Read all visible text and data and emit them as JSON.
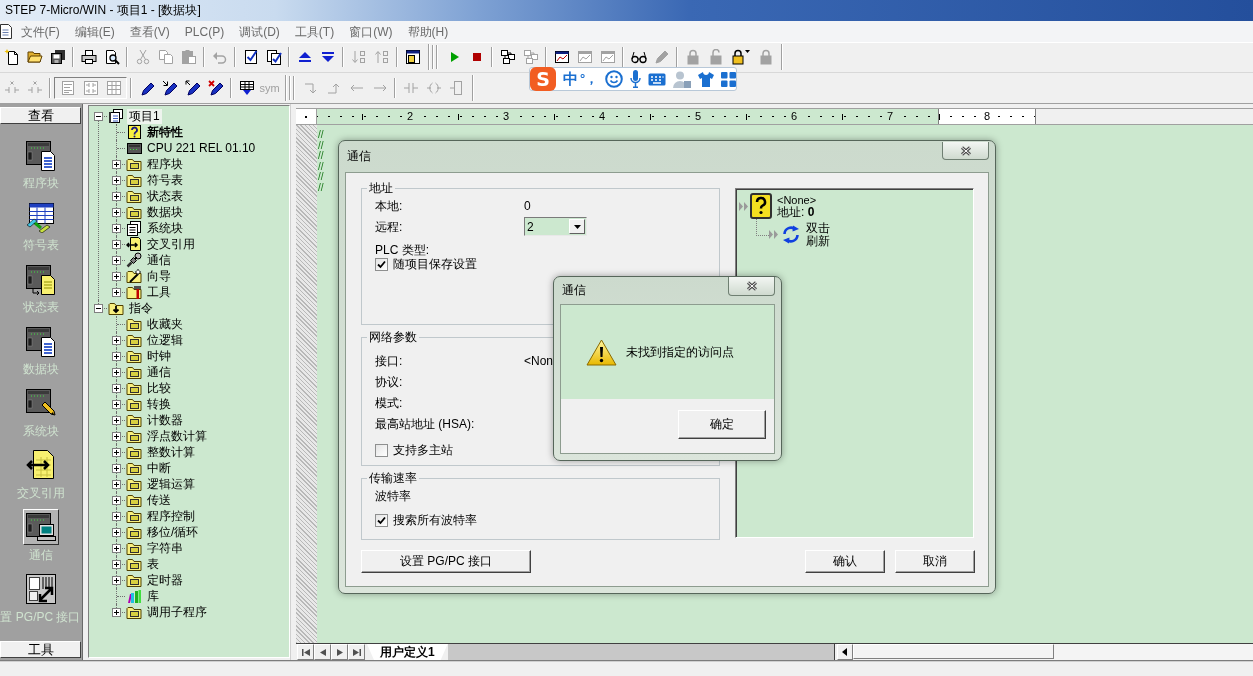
{
  "window": {
    "title": "STEP 7-Micro/WIN - 项目1 - [数据块]"
  },
  "menu": [
    "文件(F)",
    "编辑(E)",
    "查看(V)",
    "PLC(P)",
    "调试(D)",
    "工具(T)",
    "窗口(W)",
    "帮助(H)"
  ],
  "toolbar_rows": [
    {
      "bands": [
        {
          "groups": [
            {
              "items": [
                {
                  "kind": "new",
                  "disabled": false
                },
                {
                  "kind": "open",
                  "disabled": false
                },
                {
                  "kind": "save_all",
                  "disabled": false
                }
              ]
            },
            {
              "items": [
                {
                  "kind": "print",
                  "disabled": false
                },
                {
                  "kind": "print_preview",
                  "disabled": false
                }
              ]
            },
            {
              "items": [
                {
                  "kind": "cut",
                  "disabled": true
                },
                {
                  "kind": "copy",
                  "disabled": true
                },
                {
                  "kind": "paste",
                  "disabled": true
                }
              ]
            },
            {
              "items": [
                {
                  "kind": "undo",
                  "disabled": true
                }
              ]
            },
            {
              "items": [
                {
                  "kind": "compile",
                  "disabled": false
                },
                {
                  "kind": "compile_all",
                  "disabled": false
                }
              ]
            },
            {
              "items": [
                {
                  "kind": "upload",
                  "disabled": false
                },
                {
                  "kind": "download",
                  "disabled": false
                }
              ]
            },
            {
              "items": [
                {
                  "kind": "sort_ascending",
                  "disabled": true
                },
                {
                  "kind": "sort_descending",
                  "disabled": true
                }
              ]
            },
            {
              "items": [
                {
                  "kind": "options",
                  "disabled": false
                }
              ]
            }
          ]
        },
        {
          "groups": [
            {
              "items": [
                {
                  "kind": "run",
                  "disabled": false
                },
                {
                  "kind": "stop",
                  "disabled": false
                }
              ]
            },
            {
              "items": [
                {
                  "kind": "program_status",
                  "disabled": false
                },
                {
                  "kind": "status_pause",
                  "disabled": true
                }
              ]
            },
            {
              "items": [
                {
                  "kind": "chart_status",
                  "disabled": false
                },
                {
                  "kind": "chart_pause",
                  "disabled": true
                },
                {
                  "kind": "chart_single",
                  "disabled": true
                }
              ]
            },
            {
              "items": [
                {
                  "kind": "force",
                  "disabled": false
                },
                {
                  "kind": "unforce",
                  "disabled": true
                }
              ]
            },
            {
              "items": [
                {
                  "kind": "lock",
                  "disabled": true
                },
                {
                  "kind": "unlock",
                  "disabled": true
                },
                {
                  "kind": "lock_menu",
                  "disabled": false
                },
                {
                  "kind": "unlock_all",
                  "disabled": true
                }
              ]
            }
          ]
        }
      ]
    },
    {
      "bands": [
        {
          "groups": [
            {
              "items": [
                {
                  "kind": "contact_x",
                  "disabled": true
                },
                {
                  "kind": "contact_x",
                  "disabled": true
                }
              ]
            },
            {
              "framed": true,
              "items": [
                {
                  "kind": "stl_view",
                  "disabled": true
                },
                {
                  "kind": "ladder_view",
                  "disabled": true
                },
                {
                  "kind": "fbd_view",
                  "disabled": true
                }
              ]
            },
            {
              "items": [
                {
                  "kind": "pen",
                  "disabled": false
                },
                {
                  "kind": "pen_in",
                  "disabled": false
                },
                {
                  "kind": "pen_out",
                  "disabled": false
                },
                {
                  "kind": "pen_delete",
                  "disabled": false
                }
              ]
            },
            {
              "items": [
                {
                  "kind": "table_arrow",
                  "disabled": false
                },
                {
                  "kind": "symbols",
                  "label": "sym",
                  "disabled": true
                }
              ]
            }
          ]
        },
        {
          "groups": [
            {
              "items": [
                {
                  "kind": "line_down",
                  "disabled": true
                },
                {
                  "kind": "line_up",
                  "disabled": true
                },
                {
                  "kind": "line_left",
                  "disabled": true
                },
                {
                  "kind": "line_right",
                  "disabled": true
                }
              ]
            },
            {
              "items": [
                {
                  "kind": "contact",
                  "disabled": true
                },
                {
                  "kind": "coil",
                  "disabled": true
                },
                {
                  "kind": "box",
                  "disabled": true
                }
              ]
            }
          ]
        }
      ]
    }
  ],
  "ime_bar": {
    "logo": "S",
    "mode": "中",
    "punctuation": "°，"
  },
  "navigation_bar": {
    "header": "查看",
    "items": [
      {
        "kind": "program",
        "label": "程序块",
        "selected": false
      },
      {
        "kind": "symbol",
        "label": "符号表",
        "selected": false
      },
      {
        "kind": "status",
        "label": "状态表",
        "selected": false
      },
      {
        "kind": "data",
        "label": "数据块",
        "selected": false
      },
      {
        "kind": "system",
        "label": "系统块",
        "selected": false
      },
      {
        "kind": "xref",
        "label": "交叉引用",
        "selected": false
      },
      {
        "kind": "comm",
        "label": "通信",
        "selected": true
      },
      {
        "kind": "pgpc",
        "label": "置 PG/PC 接口",
        "selected": false
      }
    ],
    "footer": "工具"
  },
  "tree": [
    {
      "label": "项目1",
      "kind": "project",
      "expanded": true,
      "selected": true,
      "children": [
        {
          "label": "新特性",
          "kind": "news",
          "selected": false
        },
        {
          "label": "CPU 221 REL 01.10",
          "kind": "cpu",
          "selected": false
        },
        {
          "label": "程序块",
          "kind": "folder",
          "expanded": false,
          "selected": false
        },
        {
          "label": "符号表",
          "kind": "folder",
          "expanded": false,
          "selected": false
        },
        {
          "label": "状态表",
          "kind": "folder",
          "expanded": false,
          "selected": false
        },
        {
          "label": "数据块",
          "kind": "folder",
          "expanded": false,
          "selected": false
        },
        {
          "label": "系统块",
          "kind": "pages",
          "expanded": false,
          "selected": false
        },
        {
          "label": "交叉引用",
          "kind": "xref",
          "expanded": false,
          "selected": false
        },
        {
          "label": "通信",
          "kind": "link",
          "expanded": false,
          "selected": false
        },
        {
          "label": "向导",
          "kind": "wizard",
          "expanded": false,
          "selected": false
        },
        {
          "label": "工具",
          "kind": "tools",
          "expanded": false,
          "selected": false
        }
      ]
    },
    {
      "label": "指令",
      "kind": "instructions",
      "expanded": true,
      "selected": false,
      "children": [
        {
          "label": "收藏夹",
          "kind": "folder",
          "selected": false
        },
        {
          "label": "位逻辑",
          "kind": "folder",
          "expanded": false,
          "selected": false
        },
        {
          "label": "时钟",
          "kind": "folder",
          "expanded": false,
          "selected": false
        },
        {
          "label": "通信",
          "kind": "folder",
          "expanded": false,
          "selected": false
        },
        {
          "label": "比较",
          "kind": "folder",
          "expanded": false,
          "selected": false
        },
        {
          "label": "转换",
          "kind": "folder",
          "expanded": false,
          "selected": false
        },
        {
          "label": "计数器",
          "kind": "folder",
          "expanded": false,
          "selected": false
        },
        {
          "label": "浮点数计算",
          "kind": "folder",
          "expanded": false,
          "selected": false
        },
        {
          "label": "整数计算",
          "kind": "folder",
          "expanded": false,
          "selected": false
        },
        {
          "label": "中断",
          "kind": "folder",
          "expanded": false,
          "selected": false
        },
        {
          "label": "逻辑运算",
          "kind": "folder",
          "expanded": false,
          "selected": false
        },
        {
          "label": "传送",
          "kind": "folder",
          "expanded": false,
          "selected": false
        },
        {
          "label": "程序控制",
          "kind": "folder",
          "expanded": false,
          "selected": false
        },
        {
          "label": "移位/循环",
          "kind": "folder",
          "expanded": false,
          "selected": false
        },
        {
          "label": "字符串",
          "kind": "folder",
          "expanded": false,
          "selected": false
        },
        {
          "label": "表",
          "kind": "folder",
          "expanded": false,
          "selected": false
        },
        {
          "label": "定时器",
          "kind": "folder",
          "expanded": false,
          "selected": false
        },
        {
          "label": "库",
          "kind": "library",
          "selected": false
        },
        {
          "label": "调用子程序",
          "kind": "folder",
          "expanded": false,
          "selected": false
        }
      ]
    }
  ],
  "editor": {
    "ruler": {
      "sections": [
        {
          "labels": [
            "2",
            "3",
            "4",
            "5",
            "6",
            "7"
          ],
          "highlighted": true
        },
        {
          "labels": [
            "8"
          ],
          "highlighted": false
        }
      ]
    },
    "comment_lines": [
      "//",
      "//",
      "//",
      "//",
      "//",
      "//"
    ],
    "tabs": [
      {
        "label": "用户定义1",
        "selected": true
      }
    ]
  },
  "comm_dialog": {
    "title": "通信",
    "address_group": {
      "title": "地址",
      "local_label": "本地:",
      "local_value": "0",
      "remote_label": "远程:",
      "remote_value": "2",
      "plc_type_label": "PLC 类型:",
      "save_with_project": {
        "label": "随项目保存设置",
        "checked": true
      }
    },
    "network_group": {
      "title": "网络参数",
      "interface_label": "接口:",
      "interface_value": "<Non",
      "protocol_label": "协议:",
      "mode_label": "模式:",
      "hsa_label": "最高站地址 (HSA):",
      "multi_master": {
        "label": "支持多主站",
        "checked": false
      }
    },
    "baud_group": {
      "title": "传输速率",
      "baud_label": "波特率",
      "search_all": {
        "label": "搜索所有波特率",
        "checked": true
      }
    },
    "device_panel": {
      "device_name": "<None>",
      "device_address": "地址: **0**",
      "refresh_label": "双击刷新"
    },
    "buttons": {
      "pgpc": "设置 PG/PC 接口",
      "ok": "确认",
      "cancel": "取消"
    }
  },
  "alert_dialog": {
    "title": "通信",
    "message": "未找到指定的访问点",
    "ok": "确定"
  }
}
